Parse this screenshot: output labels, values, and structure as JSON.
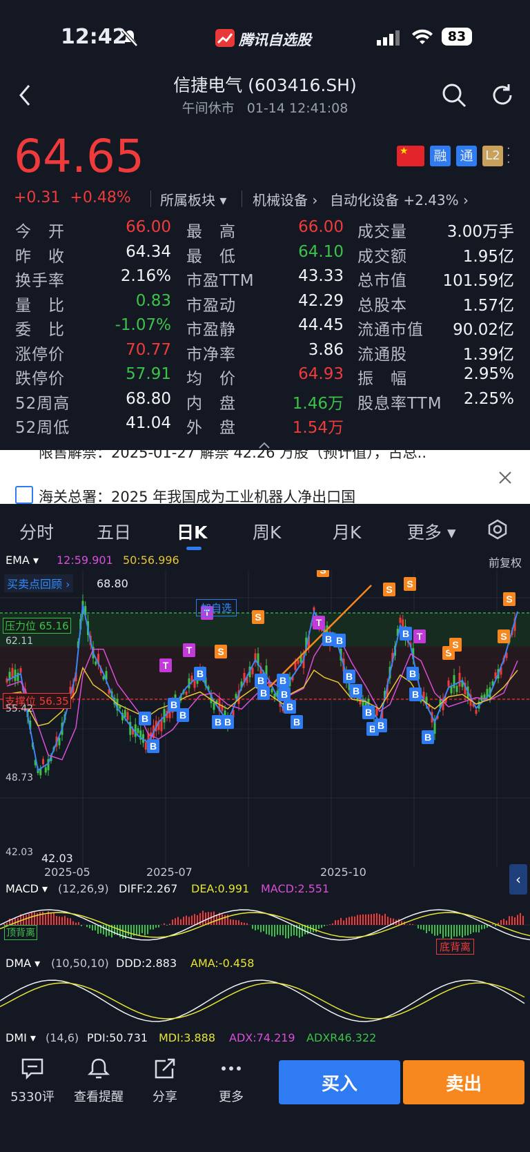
{
  "status_bar": {
    "time": "12:42",
    "app_name": "腾讯自选股",
    "battery": "83"
  },
  "header": {
    "title": "信捷电气 (603416.SH)",
    "status": "午间休市",
    "datetime": "01-14 12:41:08"
  },
  "quote": {
    "price": "64.65",
    "change": "+0.31",
    "change_pct": "+0.48%",
    "sector_label": "所属板块",
    "sector1": "机械设备",
    "sector2": "自动化设备",
    "sector2_pct": "+2.43%",
    "badges": {
      "rong": "融",
      "tong": "通",
      "l2": "L2"
    }
  },
  "stats": {
    "col1": [
      {
        "label": "今　开",
        "value": "66.00",
        "color": "red"
      },
      {
        "label": "昨　收",
        "value": "64.34",
        "color": "white"
      },
      {
        "label": "换手率",
        "value": "2.16%",
        "color": "white"
      },
      {
        "label": "量　比",
        "value": "0.83",
        "color": "green"
      },
      {
        "label": "委　比",
        "value": "-1.07%",
        "color": "green"
      },
      {
        "label": "涨停价",
        "value": "70.77",
        "color": "red"
      },
      {
        "label": "跌停价",
        "value": "57.91",
        "color": "green"
      },
      {
        "label": "52周高",
        "value": "68.80",
        "color": "white"
      },
      {
        "label": "52周低",
        "value": "41.04",
        "color": "white"
      }
    ],
    "col2": [
      {
        "label": "最　高",
        "value": "66.00",
        "color": "red"
      },
      {
        "label": "最　低",
        "value": "64.10",
        "color": "green"
      },
      {
        "label": "市盈TTM",
        "value": "43.33",
        "color": "white"
      },
      {
        "label": "市盈动",
        "value": "42.29",
        "color": "white"
      },
      {
        "label": "市盈静",
        "value": "44.45",
        "color": "white"
      },
      {
        "label": "市净率",
        "value": "3.86",
        "color": "white"
      },
      {
        "label": "均　价",
        "value": "64.93",
        "color": "red"
      },
      {
        "label": "内　盘",
        "value": "1.46万",
        "color": "green"
      },
      {
        "label": "外　盘",
        "value": "1.54万",
        "color": "red"
      }
    ],
    "col3": [
      {
        "label": "成交量",
        "value": "3.00万手"
      },
      {
        "label": "成交额",
        "value": "1.95亿"
      },
      {
        "label": "总市值",
        "value": "101.59亿"
      },
      {
        "label": "总股本",
        "value": "1.57亿"
      },
      {
        "label": "流通市值",
        "value": "90.02亿"
      },
      {
        "label": "流通股",
        "value": "1.39亿"
      },
      {
        "label": "振　幅",
        "value": "2.95%"
      },
      {
        "label": "股息率TTM",
        "value": "2.25%"
      }
    ]
  },
  "news": {
    "line1": "限售解禁：2025-01-27 解禁 42.26 万股（预计值），占总.. ",
    "line2": "海关总署：2025 年我国成为工业机器人净出口国"
  },
  "tabs": [
    "分时",
    "五日",
    "日K",
    "周K",
    "月K",
    "更多"
  ],
  "active_tab": "日K",
  "kline": {
    "ema_label": "EMA",
    "ema12": "12:59.901",
    "ema50": "50:56.996",
    "adjust": "前复权",
    "review": "买卖点回顾",
    "max_price": "68.80",
    "min_price": "42.03",
    "pressure": "压力位 65.16",
    "support": "支撑位 56.35",
    "add_watch": "加自选",
    "y_labels": [
      "62.11",
      "55.42",
      "48.73",
      "42.03"
    ],
    "x_labels": [
      "2025-05",
      "2025-07",
      "2025-10"
    ]
  },
  "macd": {
    "name": "MACD",
    "params": "(12,26,9)",
    "diff": "DIFF:2.267",
    "dea": "DEA:0.991",
    "macd": "MACD:2.551",
    "top_div": "顶背离",
    "bottom_div": "底背离"
  },
  "dma": {
    "name": "DMA",
    "params": "(10,50,10)",
    "ddd": "DDD:2.883",
    "ama": "AMA:-0.458"
  },
  "dmi": {
    "name": "DMI",
    "params": "(14,6)",
    "pdi": "PDI:50.731",
    "mdi": "MDI:3.888",
    "adx": "ADX:74.219",
    "adxr": "ADXR46.322"
  },
  "toolbar": {
    "comment": "5330评",
    "alert": "查看提醒",
    "share": "分享",
    "more": "更多",
    "buy": "买入",
    "sell": "卖出"
  },
  "colors": {
    "up": "#ef3b3b",
    "down": "#3cc24a",
    "bg": "#141822",
    "buy_btn": "#2f7bf1",
    "sell_btn": "#f7871f"
  }
}
